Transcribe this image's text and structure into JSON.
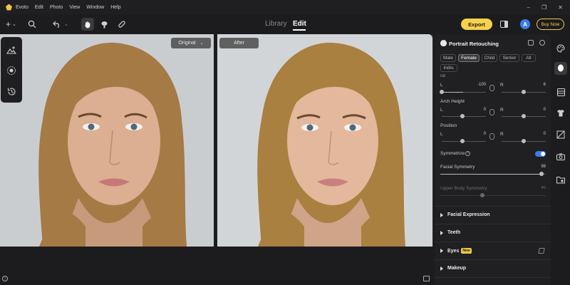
{
  "titlebar": {
    "app_name": "Evoto",
    "menus": [
      "Edit",
      "Photo",
      "View",
      "Window",
      "Help"
    ],
    "controls": [
      "–",
      "❐",
      "✕"
    ]
  },
  "toolbar": {
    "add_icon": "+",
    "tab_library": "Library",
    "tab_edit": "Edit",
    "export_label": "Export",
    "avatar_letter": "A",
    "buy_now_label": "Buy Now"
  },
  "canvas": {
    "original_label": "Original",
    "after_label": "After"
  },
  "panel": {
    "title": "Portrait Retouching",
    "chips": [
      "Male",
      "Female",
      "Child",
      "Senior",
      "All",
      "Indiv."
    ],
    "active_chip": "Female",
    "sub_label": "rat",
    "row1": {
      "l_label": "L",
      "l_value": "-100",
      "r_label": "R",
      "r_value": "6"
    },
    "arch_height": {
      "title": "Arch Height",
      "l_label": "L",
      "l_value": "0",
      "r_label": "R",
      "r_value": "0"
    },
    "position": {
      "title": "Position",
      "l_label": "L",
      "l_value": "0",
      "r_label": "R",
      "r_value": "0"
    },
    "symmetrize_label": "Symmetrize",
    "symmetrize_on": true,
    "facial_symmetry": {
      "label": "Facial Symmetry",
      "value": "98"
    },
    "upper_body_symmetry": {
      "label": "Upper Body Symmetry",
      "value": "40"
    },
    "sections": {
      "facial_expression": "Facial Expression",
      "teeth": "Teeth",
      "eyes": "Eyes",
      "eyes_badge": "New",
      "makeup": "Makeup"
    }
  },
  "colors": {
    "accent": "#f7d14b",
    "toggle": "#3b7de8",
    "background": "#1c1c1e",
    "panel": "#202022"
  }
}
